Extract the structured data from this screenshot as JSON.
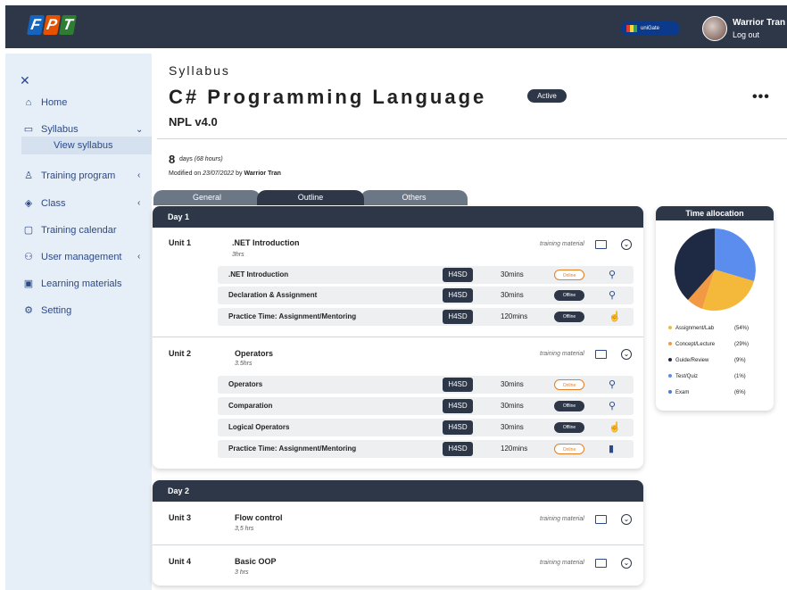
{
  "header": {
    "logo_letters": [
      "F",
      "P",
      "T"
    ],
    "unigate_label": "uniGate",
    "user_name": "Warrior Tran",
    "logout_label": "Log out"
  },
  "sidebar": {
    "items": [
      {
        "label": "Home",
        "icon": "home-icon"
      },
      {
        "label": "Syllabus",
        "icon": "book-icon"
      },
      {
        "label": "Training program",
        "icon": "training-program-icon"
      },
      {
        "label": "Class",
        "icon": "class-icon"
      },
      {
        "label": "Training calendar",
        "icon": "calendar-icon"
      },
      {
        "label": "User management",
        "icon": "users-icon"
      },
      {
        "label": "Learning materials",
        "icon": "materials-icon"
      },
      {
        "label": "Setting",
        "icon": "gear-icon"
      }
    ],
    "subitem": "View syllabus"
  },
  "page": {
    "breadcrumb": "Syllabus",
    "title": "C# Programming Language",
    "status": "Active",
    "version": "NPL v4.0",
    "days_count": "8",
    "days_text": "days",
    "hours_text": "(68 hours)",
    "modified_prefix": "Modified on",
    "modified_date": "23/07/2022",
    "modified_by_word": "by",
    "modified_by": "Warrior Tran"
  },
  "tabs": [
    {
      "label": "General",
      "active": false
    },
    {
      "label": "Outline",
      "active": true
    },
    {
      "label": "Others",
      "active": false
    }
  ],
  "days": [
    {
      "label": "Day 1",
      "units": [
        {
          "unit": "Unit 1",
          "name": ".NET Introduction",
          "duration": "3hrs",
          "material_label": "training material",
          "rows": [
            {
              "name": ".NET Introduction",
              "code": "H4SD",
              "duration": "30mins",
              "status": "Online",
              "icon": "chat-person-icon"
            },
            {
              "name": "Declaration & Assignment",
              "code": "H4SD",
              "duration": "30mins",
              "status": "Offline",
              "icon": "chat-person-icon"
            },
            {
              "name": "Practice Time: Assignment/Mentoring",
              "code": "H4SD",
              "duration": "120mins",
              "status": "Offline",
              "icon": "hand-icon"
            }
          ]
        },
        {
          "unit": "Unit 2",
          "name": "Operators",
          "duration": "3.5hrs",
          "material_label": "training material",
          "rows": [
            {
              "name": "Operators",
              "code": "H4SD",
              "duration": "30mins",
              "status": "Online",
              "icon": "chat-person-icon"
            },
            {
              "name": "Comparation",
              "code": "H4SD",
              "duration": "30mins",
              "status": "Offline",
              "icon": "chat-person-icon"
            },
            {
              "name": "Logical Operators",
              "code": "H4SD",
              "duration": "30mins",
              "status": "Offline",
              "icon": "hand-icon"
            },
            {
              "name": "Practice Time: Assignment/Mentoring",
              "code": "H4SD",
              "duration": "120mins",
              "status": "Online",
              "icon": "notebook-icon"
            }
          ]
        }
      ]
    },
    {
      "label": "Day 2",
      "units": [
        {
          "unit": "Unit 3",
          "name": "Flow control",
          "duration": "3,5 hrs",
          "material_label": "training material"
        },
        {
          "unit": "Unit 4",
          "name": "Basic OOP",
          "duration": "3 hrs",
          "material_label": "training material"
        }
      ]
    }
  ],
  "time_allocation": {
    "title": "Time allocation",
    "legend": [
      {
        "label": "Assignment/Lab",
        "pct": "(54%)",
        "value": 54,
        "color": "#f4b93b"
      },
      {
        "label": "Concept/Lecture",
        "pct": "(29%)",
        "value": 29,
        "color": "#5b8def"
      },
      {
        "label": "Guide/Review",
        "pct": "(9%)",
        "value": 9,
        "color": "#f29a43"
      },
      {
        "label": "Test/Quiz",
        "pct": "(1%)",
        "value": 1,
        "color": "#1e2a44"
      },
      {
        "label": "Exam",
        "pct": "(6%)",
        "value": 6,
        "color": "#4a7bd8"
      }
    ]
  }
}
